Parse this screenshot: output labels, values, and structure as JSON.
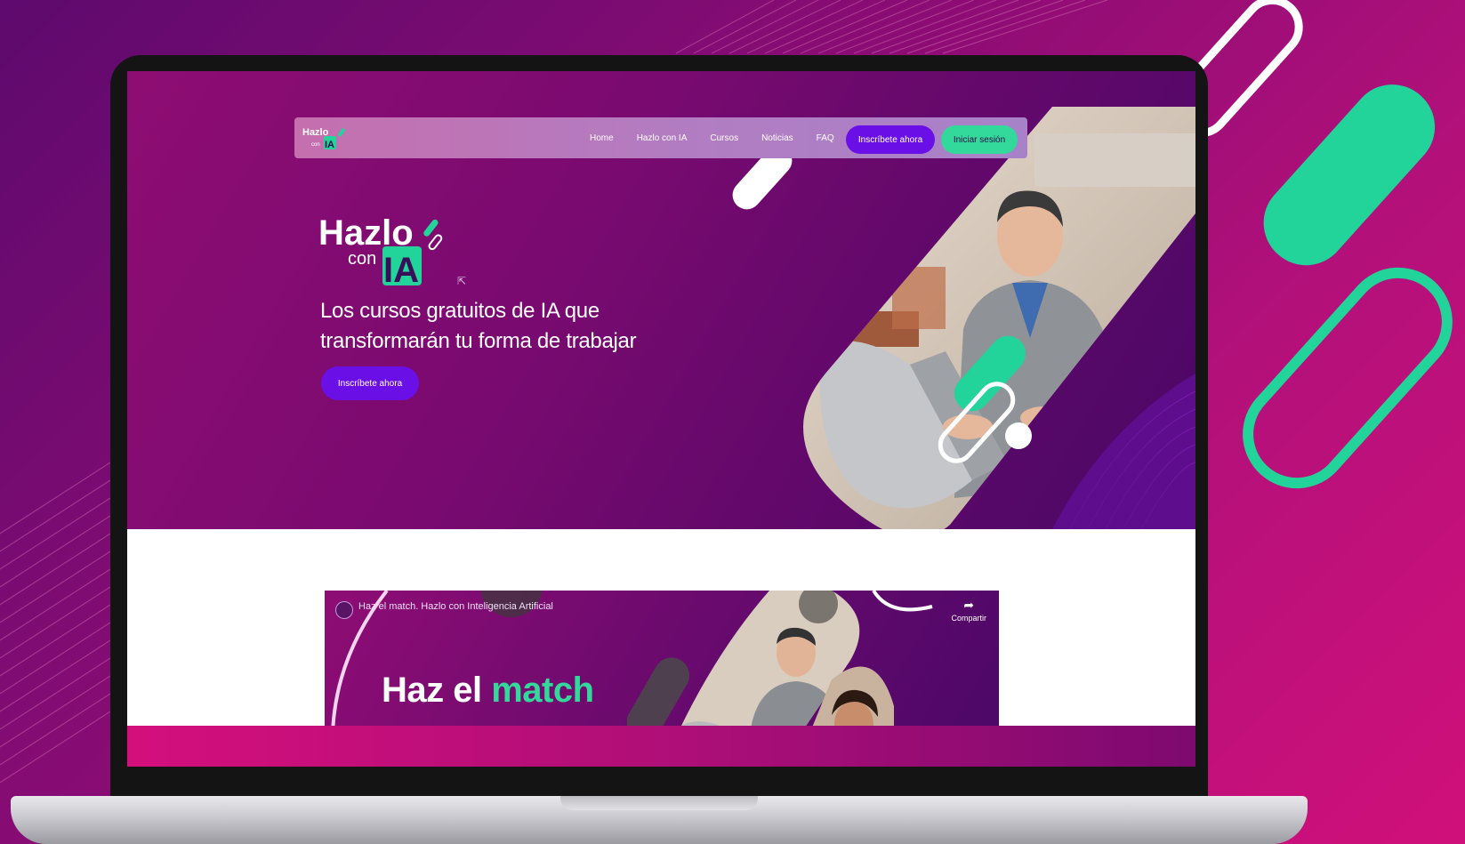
{
  "colors": {
    "brand_purple": "#6a10e6",
    "brand_green": "#33d99a",
    "magenta": "#d0107a",
    "deep_purple": "#5c086a"
  },
  "nav": {
    "logo_text": "Hazlo con IA",
    "links": [
      "Home",
      "Hazlo con IA",
      "Cursos",
      "Noticias",
      "FAQ"
    ],
    "enroll_label": "Inscríbete ahora",
    "login_label": "Iniciar sesión"
  },
  "hero": {
    "logo": {
      "word": "Hazlo",
      "small": "con",
      "badge": "IA"
    },
    "tagline_line1": "Los cursos gratuitos de IA que",
    "tagline_line2": "transformarán tu forma de trabajar",
    "cta_label": "Inscríbete ahora"
  },
  "video": {
    "title": "Haz el match. Hazlo con Inteligencia Artificial",
    "share_label": "Compartir",
    "headline_part1": "Haz el",
    "headline_part2": "match"
  },
  "icons": [
    "pill-shape",
    "cursor-icon",
    "share-icon",
    "channel-avatar"
  ]
}
